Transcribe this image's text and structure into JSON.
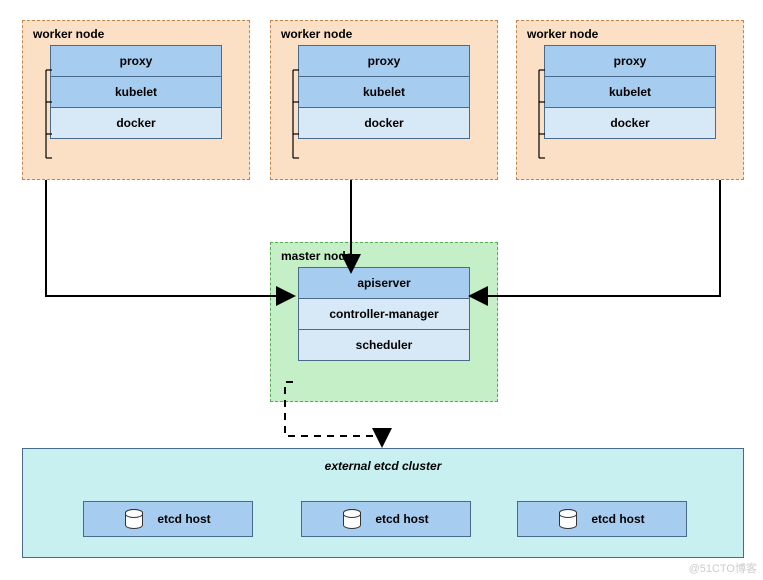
{
  "workers": [
    {
      "title": "worker node",
      "cells": [
        "proxy",
        "kubelet",
        "docker"
      ]
    },
    {
      "title": "worker node",
      "cells": [
        "proxy",
        "kubelet",
        "docker"
      ]
    },
    {
      "title": "worker node",
      "cells": [
        "proxy",
        "kubelet",
        "docker"
      ]
    }
  ],
  "master": {
    "title": "master node",
    "cells": [
      "apiserver",
      "controller-manager",
      "scheduler"
    ]
  },
  "etcd": {
    "title": "external etcd cluster",
    "hosts": [
      "etcd host",
      "etcd host",
      "etcd host"
    ]
  },
  "watermark": "@51CTO博客"
}
